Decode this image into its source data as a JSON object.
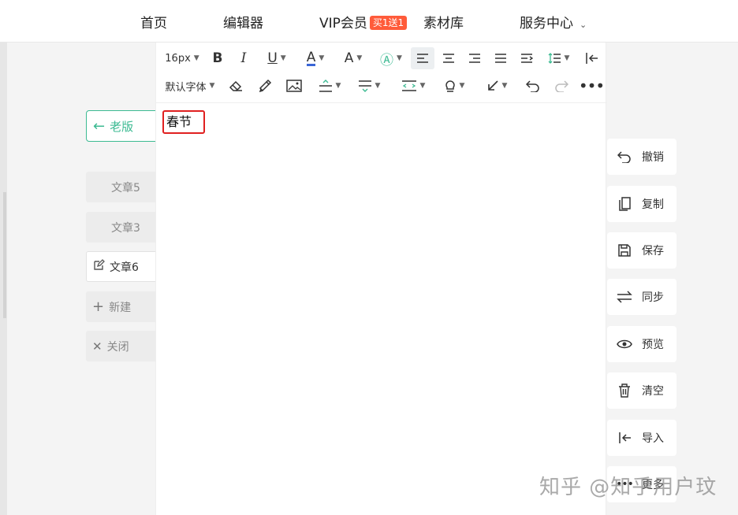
{
  "nav": {
    "home": "首页",
    "editor": "编辑器",
    "vip": "VIP会员",
    "vip_badge": "买1送1",
    "materials": "素材库",
    "service": "服务中心"
  },
  "sidebar": {
    "old_version": "老版",
    "docs": [
      "文章5",
      "文章3",
      "文章6"
    ],
    "new": "新建",
    "close": "关闭"
  },
  "toolbar": {
    "font_size": "16px",
    "font_family": "默认字体"
  },
  "editor": {
    "content": "春节"
  },
  "actions": {
    "undo": "撤销",
    "copy": "复制",
    "save": "保存",
    "sync": "同步",
    "preview": "预览",
    "clear": "清空",
    "import": "导入",
    "more": "更多"
  },
  "watermark": "知乎 @知乎用户玟",
  "colors": {
    "accent": "#3cba92",
    "badge": "#ff5b3a",
    "highlight_border": "#e02020"
  }
}
